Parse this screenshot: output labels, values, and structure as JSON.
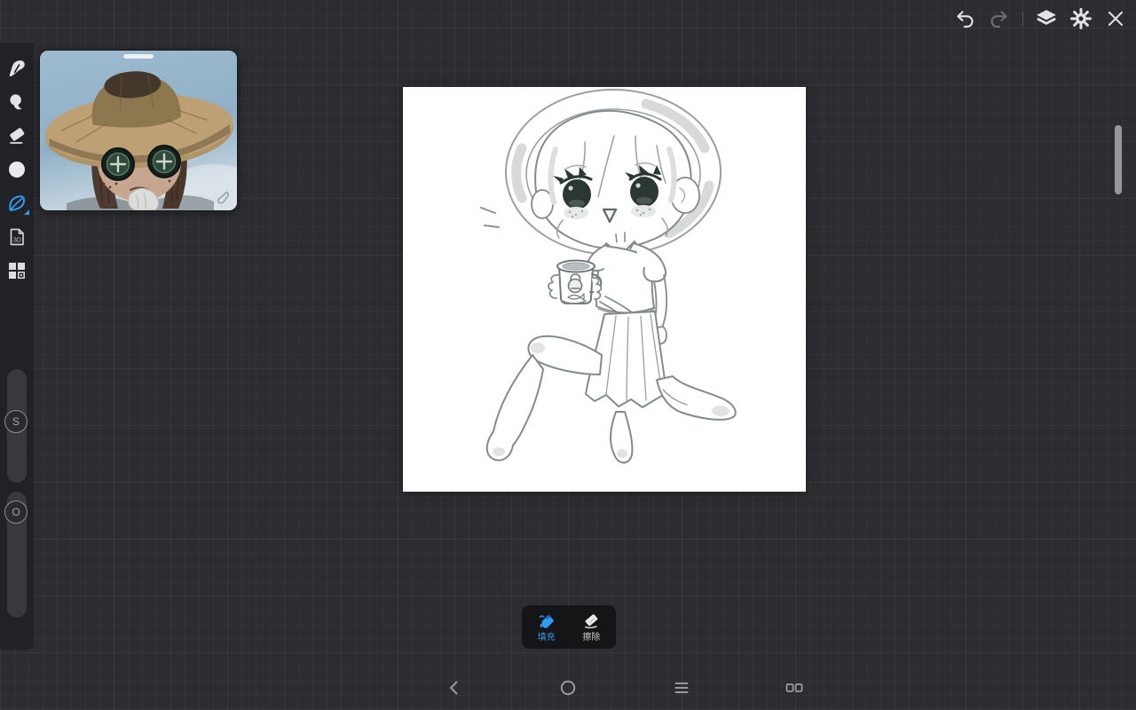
{
  "top_bar": {
    "icons": [
      {
        "name": "undo-icon",
        "enabled": true
      },
      {
        "name": "redo-icon",
        "enabled": false
      },
      {
        "name": "layers-icon",
        "enabled": true
      },
      {
        "name": "gear-icon",
        "enabled": true
      },
      {
        "name": "close-icon",
        "enabled": true
      }
    ]
  },
  "left_toolbar": {
    "tools": [
      {
        "name": "pen",
        "icon": "pen-nib-icon",
        "selected": false
      },
      {
        "name": "smudge",
        "icon": "smudge-icon",
        "selected": false
      },
      {
        "name": "eraser",
        "icon": "eraser-icon",
        "selected": false
      },
      {
        "name": "color",
        "icon": "circle-icon",
        "selected": false
      },
      {
        "name": "fill",
        "icon": "leaf-icon",
        "selected": true
      },
      {
        "name": "import-3d",
        "icon": "document-3d-icon",
        "label": "3D",
        "selected": false
      },
      {
        "name": "materials",
        "icon": "grid-squares-icon",
        "selected": false
      }
    ],
    "selected_tool_color": "#2e9bf0"
  },
  "sliders": [
    {
      "name": "brush-size",
      "label": "S"
    },
    {
      "name": "opacity",
      "label": "O"
    }
  ],
  "reference_panel": {
    "content": "identity-v-gardener-reference-photo",
    "handle_icon": "drag-handle",
    "corner_icon": "smudge-handle-icon"
  },
  "canvas": {
    "background": "#ffffff",
    "content": "line-art-chibi-girl-kneeling-holding-mug"
  },
  "fill_toolbar": {
    "buttons": [
      {
        "label": "填充",
        "icon": "paint-bucket-icon",
        "active": true,
        "color": "#2e9bf0"
      },
      {
        "label": "擦除",
        "icon": "eraser-icon",
        "active": false
      }
    ]
  },
  "nav_bar": {
    "icons": [
      "back-chevron-icon",
      "home-circle-icon",
      "recents-lines-icon",
      "split-screen-icon"
    ]
  },
  "colors": {
    "background": "#2d2c30",
    "toolbar": "#222125",
    "accent_blue": "#2e9bf0",
    "icon_light": "#e3e3e5",
    "icon_dim": "#6e6e72"
  }
}
